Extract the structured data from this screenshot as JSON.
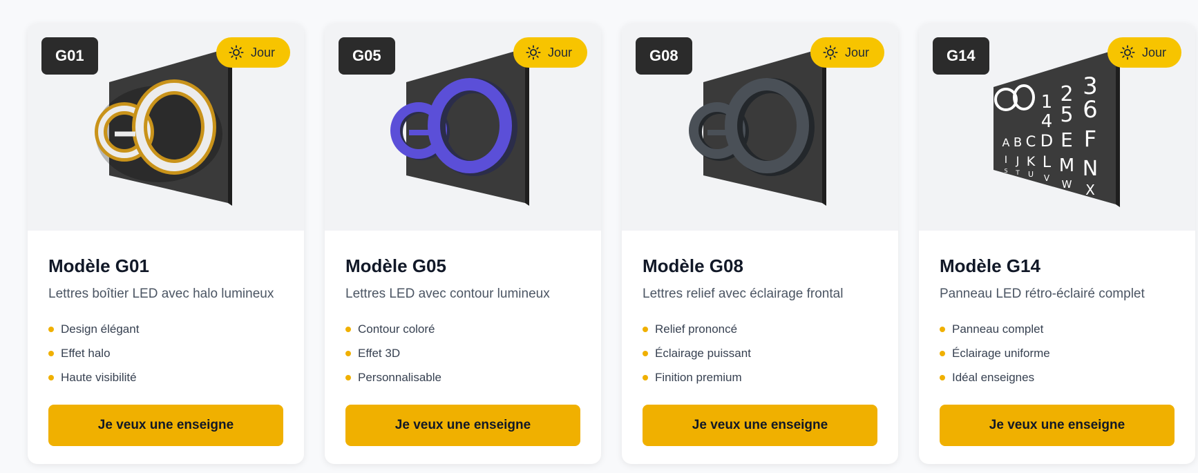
{
  "cards": [
    {
      "code": "G01",
      "mode": "Jour",
      "title": "Modèle G01",
      "subtitle": "Lettres boîtier LED avec halo lumineux",
      "features": [
        "Design élégant",
        "Effet halo",
        "Haute visibilité"
      ],
      "cta": "Je veux une enseigne"
    },
    {
      "code": "G05",
      "mode": "Jour",
      "title": "Modèle G05",
      "subtitle": "Lettres LED avec contour lumineux",
      "features": [
        "Contour coloré",
        "Effet 3D",
        "Personnalisable"
      ],
      "cta": "Je veux une enseigne"
    },
    {
      "code": "G08",
      "mode": "Jour",
      "title": "Modèle G08",
      "subtitle": "Lettres relief avec éclairage frontal",
      "features": [
        "Relief prononcé",
        "Éclairage puissant",
        "Finition premium"
      ],
      "cta": "Je veux une enseigne"
    },
    {
      "code": "G14",
      "mode": "Jour",
      "title": "Modèle G14",
      "subtitle": "Panneau LED rétro-éclairé complet",
      "features": [
        "Panneau complet",
        "Éclairage uniforme",
        "Idéal enseignes"
      ],
      "cta": "Je veux une enseigne"
    }
  ],
  "panel_characters": {
    "row1": [
      "1",
      "2",
      "3"
    ],
    "row2": [
      "4",
      "5",
      "6"
    ],
    "row3": [
      "A",
      "B",
      "C",
      "D",
      "E",
      "F"
    ],
    "row4": [
      "I",
      "J",
      "K",
      "L",
      "M",
      "N"
    ],
    "row5": [
      "S",
      "T",
      "U",
      "V",
      "W",
      "X"
    ]
  },
  "colors": {
    "accent": "#f0b000",
    "badge_day": "#f7c400",
    "badge_code": "#2b2b2b",
    "g05_letters": "#5b4fd8",
    "g01_gold": "#c9931a",
    "g08_letters": "#3a3f45",
    "panel": "#3b3b3b"
  },
  "icons": {
    "mode_icon": "sun-icon"
  }
}
